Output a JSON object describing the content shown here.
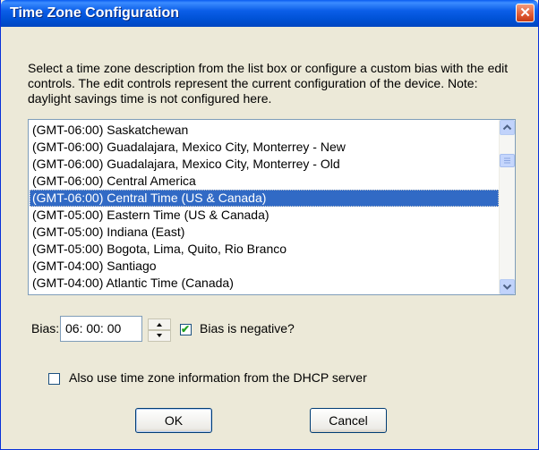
{
  "window": {
    "title": "Time Zone Configuration",
    "close_symbol": "✕"
  },
  "description": "Select a time zone description from the list box or configure a custom bias with the edit controls.  The edit controls represent the current configuration of the device.  Note: daylight savings time is not configured here.",
  "timezone_list": {
    "items": [
      "(GMT-06:00) Saskatchewan",
      "(GMT-06:00) Guadalajara, Mexico City, Monterrey - New",
      "(GMT-06:00) Guadalajara, Mexico City, Monterrey - Old",
      "(GMT-06:00) Central America",
      "(GMT-06:00) Central Time (US & Canada)",
      "(GMT-05:00) Eastern Time (US & Canada)",
      "(GMT-05:00) Indiana (East)",
      "(GMT-05:00) Bogota, Lima, Quito, Rio Branco",
      "(GMT-04:00) Santiago",
      "(GMT-04:00) Atlantic Time (Canada)"
    ],
    "selected": "(GMT-06:00) Central Time (US & Canada)"
  },
  "bias": {
    "label": "Bias:",
    "value": "06: 00: 00"
  },
  "bias_negative": {
    "label": "Bias is negative?",
    "checked": true,
    "check_symbol": "✔"
  },
  "dhcp": {
    "label": "Also use time zone information from the DHCP server",
    "checked": false
  },
  "buttons": {
    "ok": "OK",
    "cancel": "Cancel"
  },
  "icons": {
    "close": "close-icon",
    "scroll_up": "chevron-up-icon",
    "scroll_down": "chevron-down-icon",
    "spin_up": "triangle-up-icon",
    "spin_down": "triangle-down-icon"
  },
  "colors": {
    "titlebar": "#0054e3",
    "selection": "#316ac5",
    "dialog_face": "#ece9d8",
    "close_button": "#e05a32"
  }
}
